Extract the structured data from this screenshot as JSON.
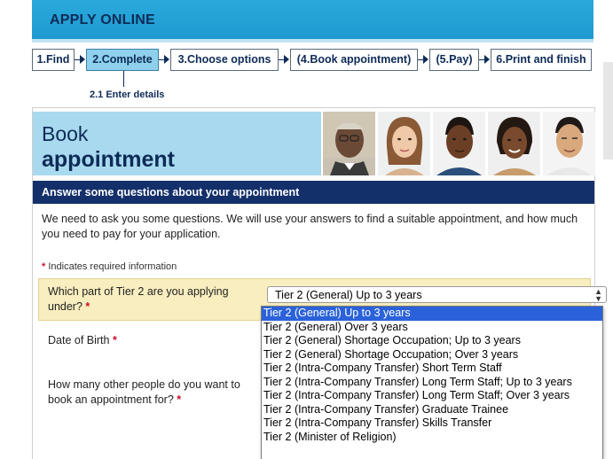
{
  "banner": {
    "title": "APPLY ONLINE"
  },
  "steps": [
    {
      "label": "1.Find"
    },
    {
      "label": "2.Complete",
      "active": true
    },
    {
      "label": "3.Choose options"
    },
    {
      "label": "(4.Book appointment)"
    },
    {
      "label": "(5.Pay)"
    },
    {
      "label": "6.Print and finish"
    }
  ],
  "substep": {
    "label": "2.1 Enter details"
  },
  "hero": {
    "line1": "Book",
    "line2": "appointment"
  },
  "section": {
    "title": "Answer some questions about your appointment"
  },
  "intro": {
    "text": "We need to ask you some questions. We will use your answers to find a suitable appointment, and how much you need to pay for your application."
  },
  "required_note": {
    "star": "*",
    "text": " Indicates required information"
  },
  "questions": {
    "tier_part": {
      "label": "Which part of Tier 2 are you applying under?",
      "star": " *"
    },
    "dob": {
      "label": "Date of Birth",
      "star": " *"
    },
    "others": {
      "label": "How many other people do you want to book an appointment for?",
      "star": " *"
    }
  },
  "select": {
    "value": "Tier 2 (General) Up to 3 years",
    "arrows_up": "▲",
    "arrows_down": "▼"
  },
  "dropdown_options": [
    "Tier 2 (General) Up to 3 years",
    "Tier 2 (General) Over 3 years",
    "Tier 2 (General) Shortage Occupation; Up to 3 years",
    "Tier 2 (General) Shortage Occupation; Over 3 years",
    "Tier 2 (Intra-Company Transfer) Short Term Staff",
    "Tier 2 (Intra-Company Transfer) Long Term Staff; Up to 3 years",
    "Tier 2 (Intra-Company Transfer) Long Term Staff; Over 3 years",
    "Tier 2 (Intra-Company Transfer) Graduate Trainee",
    "Tier 2 (Intra-Company Transfer) Skills Transfer",
    "Tier 2 (Minister of Religion)"
  ],
  "colors": {
    "banner": "#1e9ad0",
    "navy": "#0d2b57",
    "section_bar": "#14306a",
    "highlight_row": "#f8eebf",
    "selected_option": "#2b62d9",
    "required_star": "#c8102e"
  },
  "icons": [
    "step-arrow-icon",
    "select-arrows-icon"
  ]
}
